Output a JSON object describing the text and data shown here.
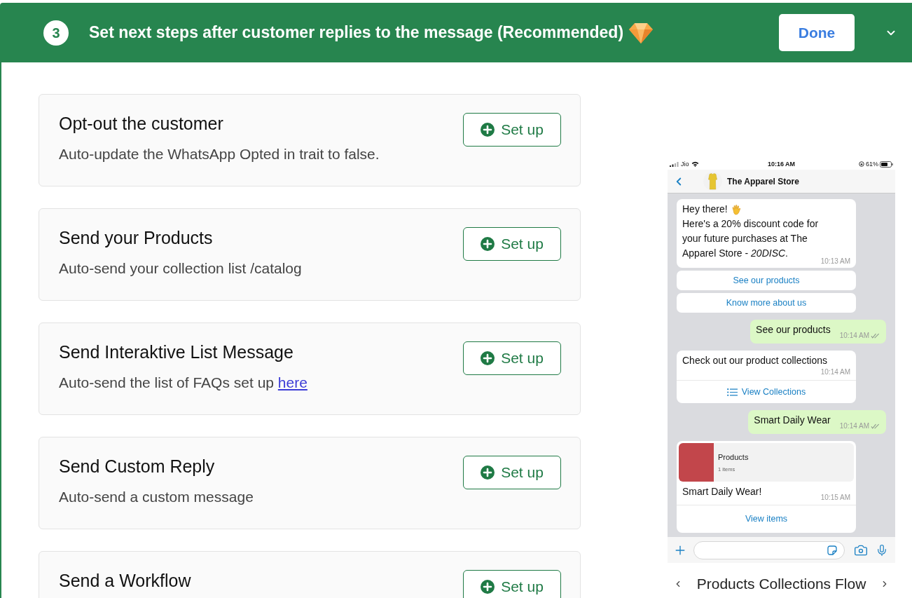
{
  "header": {
    "step": "3",
    "title": "Set next steps after customer replies to the message (Recommended)",
    "done_button": "Done"
  },
  "actions": [
    {
      "title": "Opt-out the customer",
      "description": "Auto-update the WhatsApp Opted in trait to false.",
      "button": "Set up"
    },
    {
      "title": "Send your Products",
      "description": "Auto-send your collection list /catalog",
      "button": "Set up"
    },
    {
      "title": "Send Interaktive List Message",
      "description": "Auto-send the list of FAQs set up",
      "link": "here",
      "button": "Set up"
    },
    {
      "title": "Send Custom Reply",
      "description": "Auto-send a custom message",
      "button": "Set up"
    },
    {
      "title": "Send a Workflow",
      "button": "Set up"
    }
  ],
  "preview": {
    "status_bar": {
      "carrier": "Jio",
      "time": "10:16 AM",
      "battery": "61%"
    },
    "contact": "The Apparel Store",
    "messages": [
      {
        "kind": "received",
        "greeting": "Hey there!",
        "text": "Here's a 20% discount code for your future purchases at The Apparel Store - *20DISC*.",
        "time": "10:13 AM"
      },
      {
        "kind": "quick_reply",
        "label": "See our products"
      },
      {
        "kind": "quick_reply",
        "label": "Know more about us"
      },
      {
        "kind": "sent",
        "text": "See our products",
        "time": "10:14 AM"
      },
      {
        "kind": "list",
        "text": "Check out our product collections",
        "time": "10:14 AM",
        "action": "View Collections"
      },
      {
        "kind": "sent",
        "text": "Smart Daily Wear",
        "time": "10:14 AM"
      },
      {
        "kind": "product",
        "header_title": "Products",
        "header_subtitle": "1 items",
        "text": "Smart Daily Wear!",
        "time": "10:15 AM",
        "action": "View items"
      }
    ],
    "caption": "Products Collections Flow"
  }
}
